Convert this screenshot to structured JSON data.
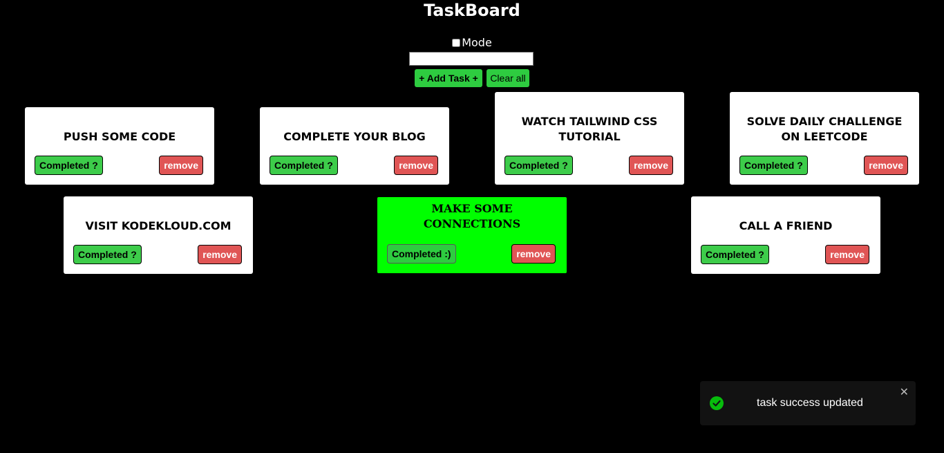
{
  "app": {
    "title": "TaskBoard",
    "mode_label": "Mode",
    "input_value": "",
    "add_button": "+ Add Task +",
    "clear_button": "Clear all"
  },
  "tasks": [
    {
      "title": "push some code",
      "status_label": "Completed ?",
      "remove_label": "remove",
      "completed": false
    },
    {
      "title": "complete your blog",
      "status_label": "Completed ?",
      "remove_label": "remove",
      "completed": false
    },
    {
      "title": "watch tailwind css tutorial",
      "status_label": "Completed ?",
      "remove_label": "remove",
      "completed": false
    },
    {
      "title": "solve daily challenge on leetcode",
      "status_label": "Completed ?",
      "remove_label": "remove",
      "completed": false
    },
    {
      "title": "visit kodekloud.com",
      "status_label": "Completed ?",
      "remove_label": "remove",
      "completed": false
    },
    {
      "title": "make some connections",
      "status_label": "Completed :)",
      "remove_label": "remove",
      "completed": true
    },
    {
      "title": "call a friend",
      "status_label": "Completed ?",
      "remove_label": "remove",
      "completed": false
    }
  ],
  "toast": {
    "message": "task success updated",
    "close_glyph": "✕",
    "icon": "check-circle-icon"
  },
  "colors": {
    "background": "#000000",
    "card": "#ffffff",
    "completed_card": "#00ff00",
    "button_green": "#3dcc4a",
    "button_red": "#e05555",
    "toast_bg": "#121212",
    "success": "#07bc0c"
  }
}
